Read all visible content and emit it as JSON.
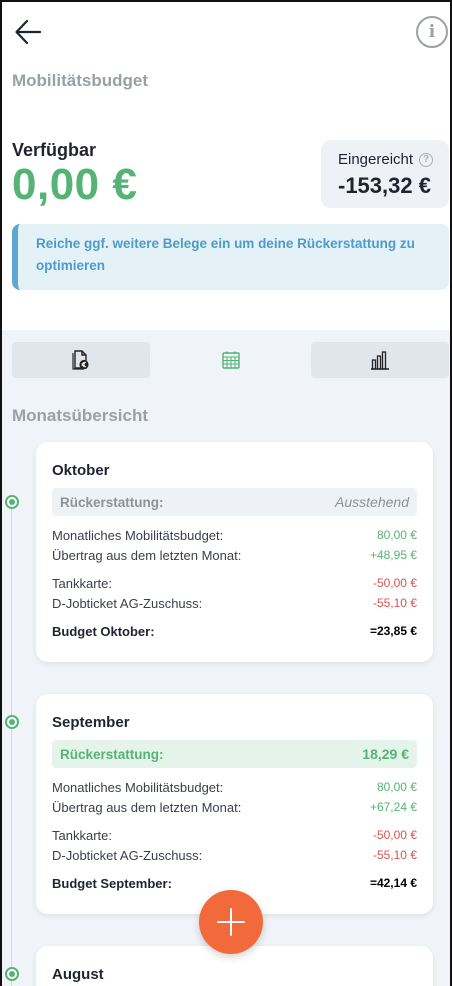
{
  "header": {
    "back_icon": "arrow-left-icon",
    "info_icon": "info-icon",
    "info_glyph": "i",
    "title": "Mobilitätsbudget"
  },
  "balance": {
    "available_label": "Verfügbar",
    "available_value": "0,00 €",
    "submitted_label": "Eingereicht",
    "help_glyph": "?",
    "submitted_value": "-153,32 €"
  },
  "hint": {
    "text": "Reiche ggf. weitere Belege ein um deine Rückerstattung zu optimieren"
  },
  "tabs": [
    {
      "icon": "document-euro-icon",
      "active": false
    },
    {
      "icon": "calendar-icon",
      "active": true
    },
    {
      "icon": "bar-chart-icon",
      "active": false
    }
  ],
  "overview": {
    "title": "Monatsübersicht",
    "months": [
      {
        "name": "Oktober",
        "refund_label": "Rückerstattung:",
        "refund_value": "Ausstehend",
        "lines": [
          {
            "label": "Monatliches Mobilitätsbudget:",
            "value": "80,00 €"
          },
          {
            "label": "Übertrag aus dem letzten Monat:",
            "value": "+48,95 €"
          },
          {
            "label": "Tankkarte:",
            "value": "-50,00 €"
          },
          {
            "label": "D-Jobticket AG-Zuschuss:",
            "value": "-55,10 €"
          }
        ],
        "total_label": "Budget Oktober:",
        "total_value": "=23,85 €"
      },
      {
        "name": "September",
        "refund_label": "Rückerstattung:",
        "refund_value": "18,29 €",
        "lines": [
          {
            "label": "Monatliches Mobilitätsbudget:",
            "value": "80,00 €"
          },
          {
            "label": "Übertrag aus dem letzten Monat:",
            "value": "+67,24 €"
          },
          {
            "label": "Tankkarte:",
            "value": "-50,00 €"
          },
          {
            "label": "D-Jobticket AG-Zuschuss:",
            "value": "-55,10 €"
          }
        ],
        "total_label": "Budget September:",
        "total_value": "=42,14 €"
      },
      {
        "name": "August"
      }
    ]
  },
  "fab": {
    "icon": "plus-icon"
  },
  "colors": {
    "green": "#55b376",
    "red": "#d9534f",
    "accent_blue": "#4e9bc9",
    "fab_orange": "#f26a3c"
  }
}
